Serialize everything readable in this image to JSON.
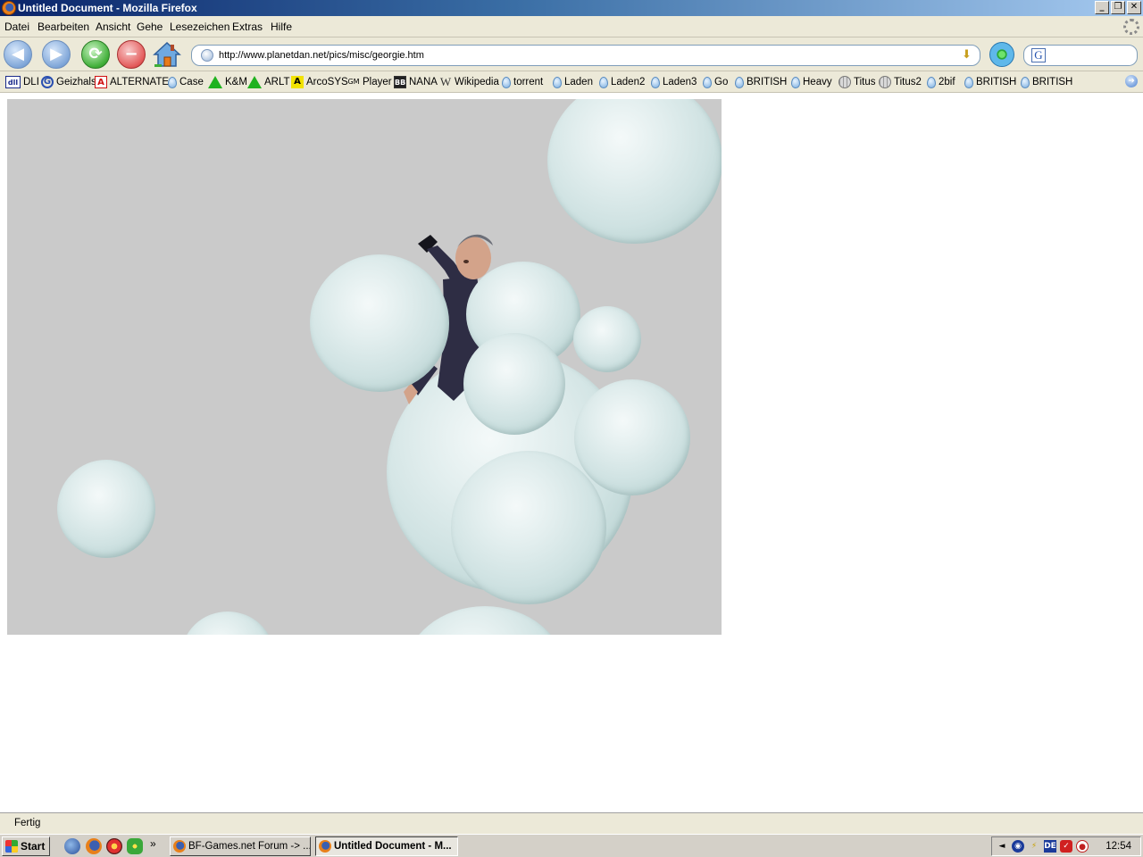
{
  "window": {
    "title": "Untitled Document - Mozilla Firefox",
    "buttons": {
      "minimize": "_",
      "maximize": "❐",
      "close": "✕"
    }
  },
  "menu": [
    "Datei",
    "Bearbeiten",
    "Ansicht",
    "Gehe",
    "Lesezeichen",
    "Extras",
    "Hilfe"
  ],
  "navigation": {
    "url": "http://www.planetdan.net/pics/misc/georgie.htm",
    "search_engine_glyph": "G"
  },
  "bookmarks": [
    {
      "label": "DLI",
      "icon": "dli-icon"
    },
    {
      "label": "Geizhals",
      "icon": "geizhals-icon"
    },
    {
      "label": "ALTERNATE",
      "icon": "alternate-icon"
    },
    {
      "label": "Case",
      "icon": "pin-icon"
    },
    {
      "label": "K&M",
      "icon": "triangle-icon"
    },
    {
      "label": "ARLT",
      "icon": "triangle-icon"
    },
    {
      "label": "ArcoSYS",
      "icon": "arcosys-icon"
    },
    {
      "label": "Player",
      "icon": "gm-icon"
    },
    {
      "label": "NANA",
      "icon": "bb-icon"
    },
    {
      "label": "Wikipedia",
      "icon": "wikipedia-icon"
    },
    {
      "label": "torrent",
      "icon": "pin-icon"
    },
    {
      "label": "Laden",
      "icon": "pin-icon"
    },
    {
      "label": "Laden2",
      "icon": "pin-icon"
    },
    {
      "label": "Laden3",
      "icon": "pin-icon"
    },
    {
      "label": "Go",
      "icon": "pin-icon"
    },
    {
      "label": "BRITISH",
      "icon": "pin-icon"
    },
    {
      "label": "Heavy",
      "icon": "pin-icon"
    },
    {
      "label": "Titus",
      "icon": "globe-icon"
    },
    {
      "label": "Titus2",
      "icon": "globe-icon"
    },
    {
      "label": "2bif",
      "icon": "pin-icon"
    },
    {
      "label": "BRITISH",
      "icon": "pin-icon"
    },
    {
      "label": "BRITISH",
      "icon": "pin-icon"
    }
  ],
  "bookmark_icon_glyphs": {
    "dli": "dll",
    "geizhals": "G",
    "alternate": "A",
    "gm": "GM",
    "bb": "BB",
    "wikipedia": "W",
    "arcosys": "A"
  },
  "status": {
    "text": "Fertig"
  },
  "taskbar": {
    "start_label": "Start",
    "overflow": "»",
    "tasks": [
      {
        "label": "BF-Games.net Forum -> ...",
        "active": false
      },
      {
        "label": "Untitled Document - M...",
        "active": true
      }
    ],
    "tray": {
      "language": "DE",
      "clock": "12:54"
    }
  },
  "colors": {
    "titlebar_start": "#0a246a",
    "stage_background": "#cacaca",
    "bubble": "#d9e9e8",
    "suit": "#2e2d44",
    "skin": "#d3a38a"
  }
}
